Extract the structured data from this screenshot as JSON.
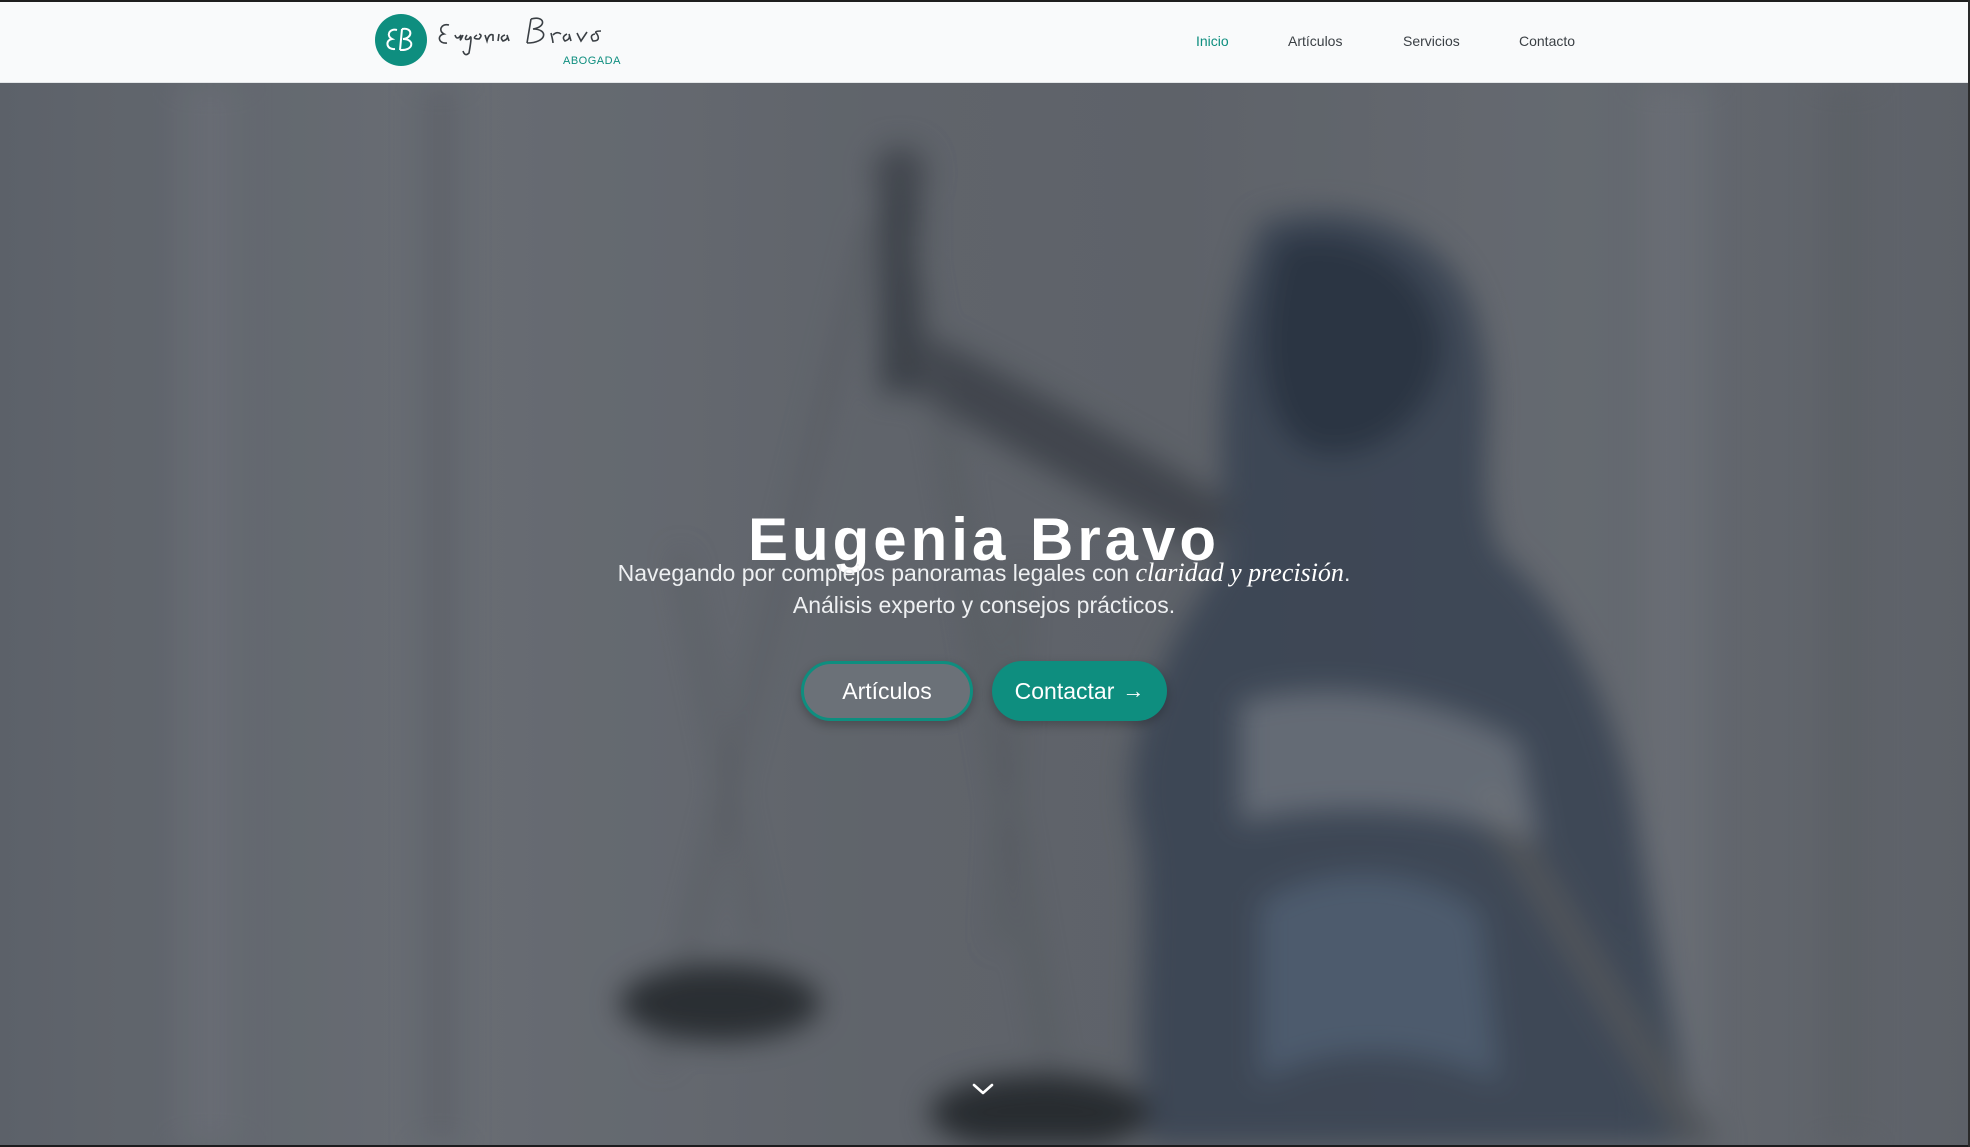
{
  "brand": {
    "monogram": "EB",
    "name": "Eugenia Bravo",
    "subtitle": "ABOGADA",
    "accent_color": "#0e8e7f"
  },
  "nav": {
    "items": [
      {
        "label": "Inicio",
        "active": true
      },
      {
        "label": "Artículos",
        "active": false
      },
      {
        "label": "Servicios",
        "active": false
      },
      {
        "label": "Contacto",
        "active": false
      }
    ]
  },
  "hero": {
    "title": "Eugenia Bravo",
    "subtitle_line1_prefix": "Navegando por complejos panoramas legales con ",
    "subtitle_line1_emphasis": "claridad y precisión",
    "subtitle_line1_suffix": ".",
    "subtitle_line2": "Análisis experto y consejos prácticos.",
    "button_secondary": "Artículos",
    "button_primary": "Contactar",
    "button_primary_icon": "arrow-right-icon",
    "scroll_icon": "chevron-down-icon"
  }
}
